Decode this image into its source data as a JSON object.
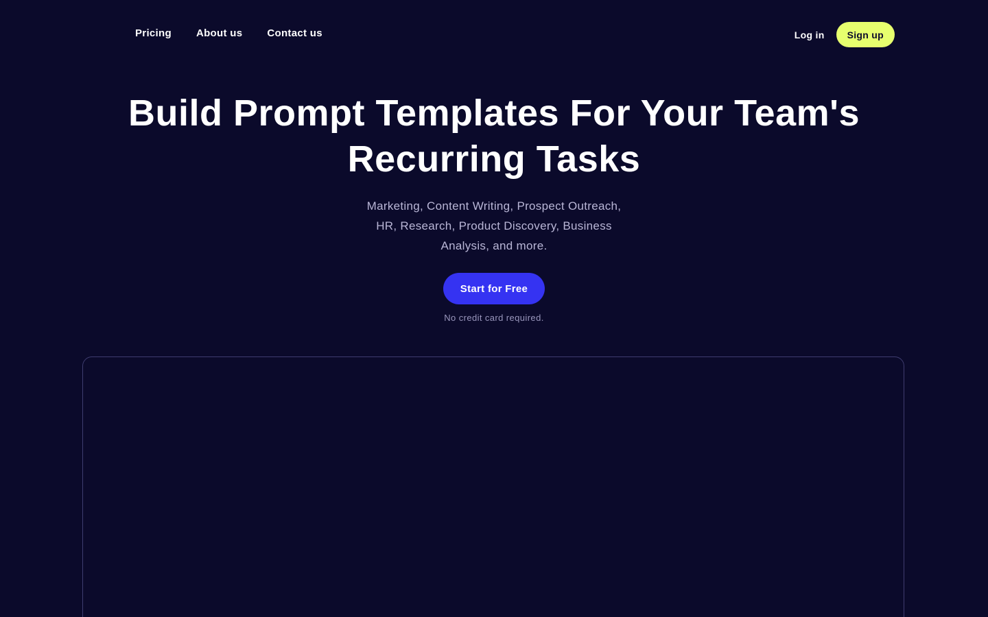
{
  "nav": {
    "links": [
      {
        "label": "Pricing"
      },
      {
        "label": "About us"
      },
      {
        "label": "Contact us"
      }
    ],
    "login_label": "Log in",
    "signup_label": "Sign up"
  },
  "hero": {
    "title": "Build Prompt Templates For Your Team's Recurring Tasks",
    "subtitle": "Marketing, Content Writing, Prospect Outreach, HR, Research, Product Discovery, Business Analysis, and more.",
    "cta_label": "Start for Free",
    "cta_note": "No credit card required."
  },
  "colors": {
    "background": "#0b0a2b",
    "accent_primary": "#3533f2",
    "accent_signup": "#e7ff6e",
    "subtitle_text": "#b9b6d6"
  }
}
